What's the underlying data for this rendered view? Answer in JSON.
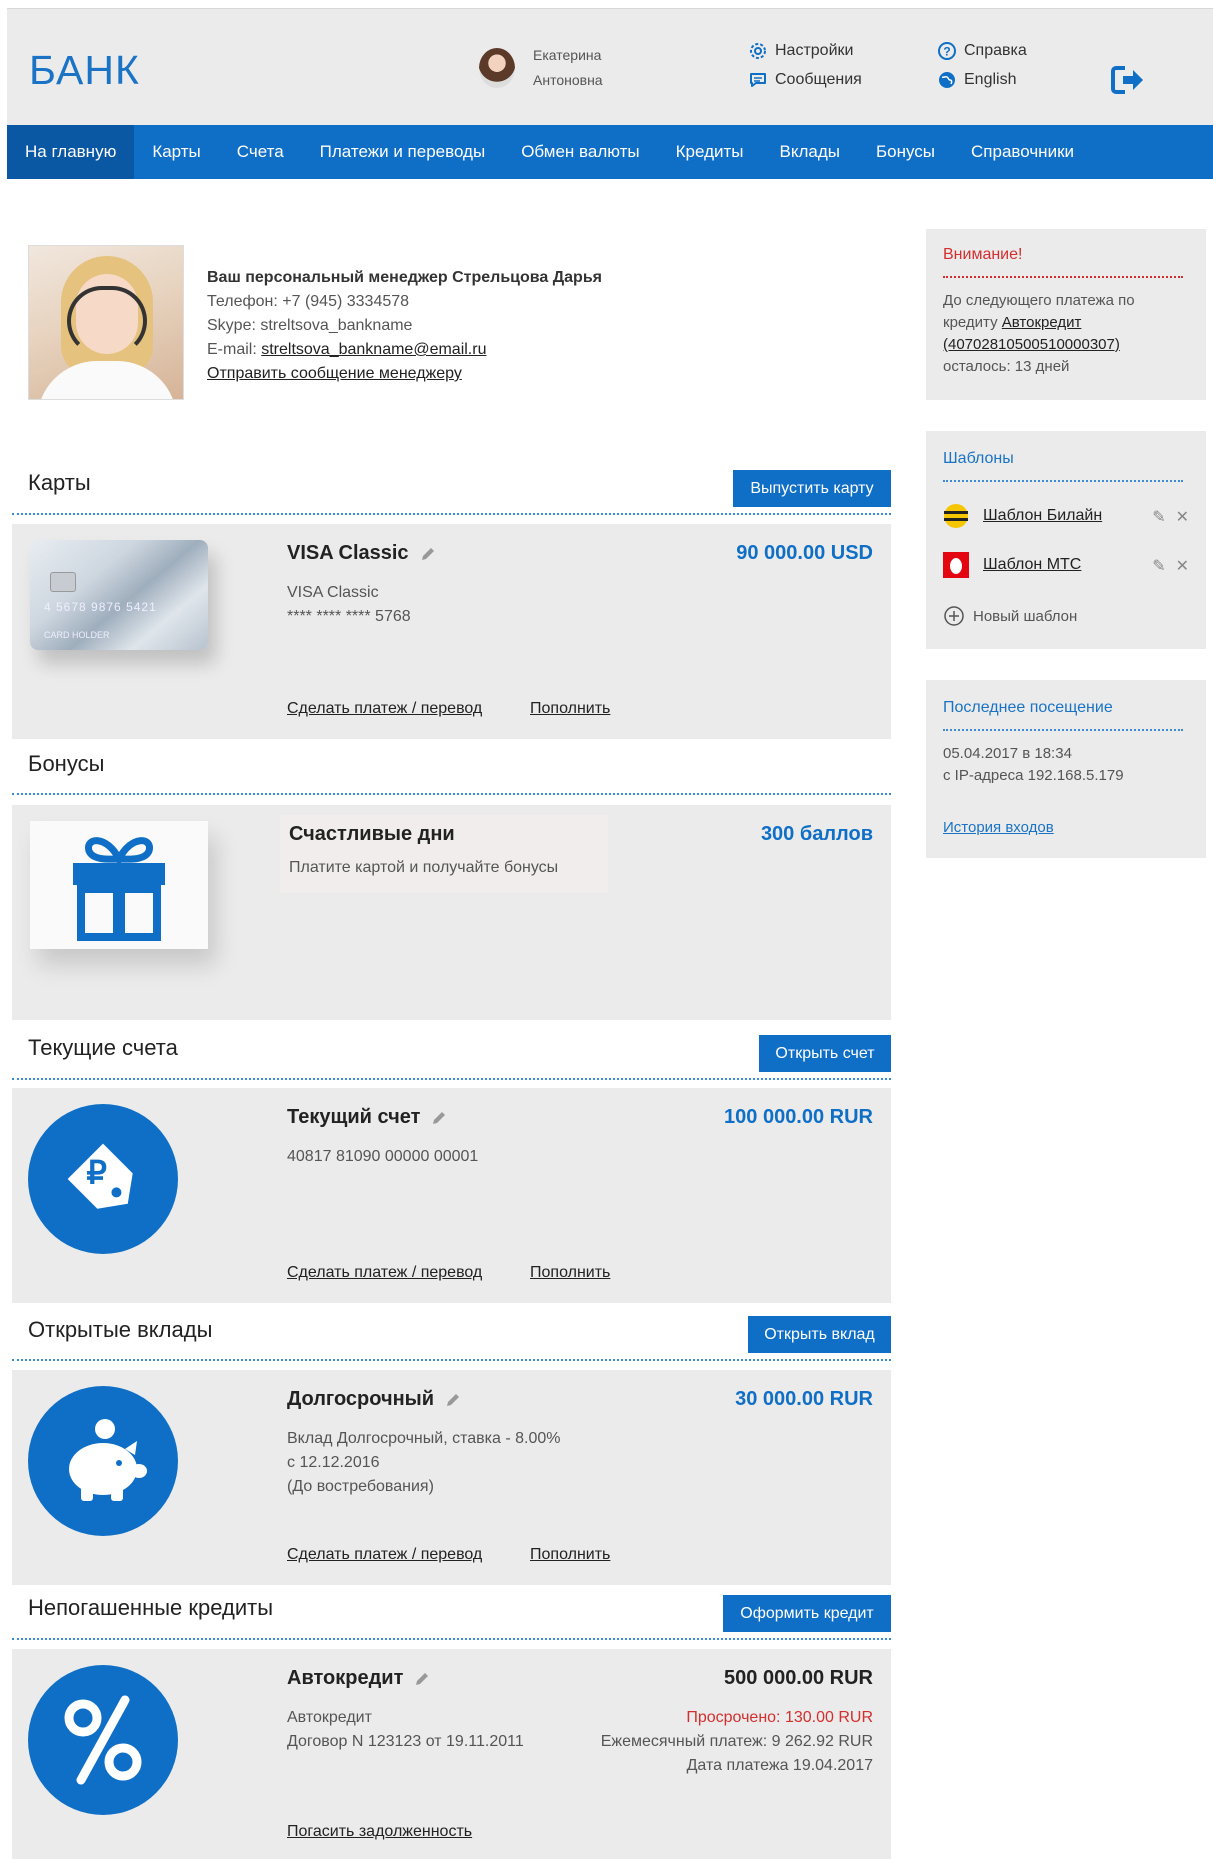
{
  "header": {
    "logo": "БАНК",
    "user_first": "Екатерина",
    "user_last": "Антоновна",
    "settings": "Настройки",
    "messages": "Сообщения",
    "help": "Справка",
    "language": "English"
  },
  "nav": [
    "На главную",
    "Карты",
    "Счета",
    "Платежи и переводы",
    "Обмен валюты",
    "Кредиты",
    "Вклады",
    "Бонусы",
    "Справочники"
  ],
  "manager": {
    "title": "Ваш персональный менеджер Стрельцова Дарья",
    "phone": "Телефон: +7 (945) 3334578",
    "skype": "Skype: streltsova_bankname",
    "email_label": "E-mail: ",
    "email": "streltsova_bankname@email.ru",
    "send_message": "Отправить сообщение менеджеру"
  },
  "cards": {
    "title": "Карты",
    "button": "Выпустить карту",
    "item": {
      "name": "VISA Classic",
      "amount": "90 000.00 USD",
      "desc": "VISA Classic",
      "number": "**** **** **** 5768",
      "card_number_print": "4 5678 9876 5421",
      "card_holder": "CARD HOLDER",
      "pay": "Сделать платеж / перевод",
      "topup": "Пополнить"
    }
  },
  "bonuses": {
    "title": "Бонусы",
    "item": {
      "name": "Счастливые дни",
      "amount": "300 баллов",
      "desc": "Платите картой и получайте бонусы"
    }
  },
  "accounts": {
    "title": "Текущие счета",
    "button": "Открыть счет",
    "item": {
      "name": "Текущий счет",
      "amount": "100 000.00 RUR",
      "number": "40817 81090 00000 00001",
      "pay": "Сделать платеж / перевод",
      "topup": "Пополнить"
    }
  },
  "deposits": {
    "title": "Открытые вклады",
    "button": "Открыть вклад",
    "item": {
      "name": "Долгосрочный",
      "amount": "30 000.00 RUR",
      "desc1": "Вклад Долгосрочный, ставка - 8.00%",
      "desc2": "с 12.12.2016",
      "desc3": "(До востребования)",
      "pay": "Сделать платеж / перевод",
      "topup": "Пополнить"
    }
  },
  "credits": {
    "title": "Непогашенные кредиты",
    "button": "Оформить кредит",
    "item": {
      "name": "Автокредит",
      "amount": "500 000.00 RUR",
      "desc1": "Автокредит",
      "desc2": "Договор N 123123 от 19.11.2011",
      "overdue": "Просрочено: 130.00 RUR",
      "monthly": "Ежемесячный платеж: 9 262.92 RUR",
      "date": "Дата платежа 19.04.2017",
      "repay": "Погасить задолженность"
    }
  },
  "sidebar": {
    "attention": {
      "title": "Внимание!",
      "text1": "До следующего платежа по кредиту ",
      "link": "Автокредит (40702810500510000307)",
      "text2": "осталось: 13 дней"
    },
    "templates": {
      "title": "Шаблоны",
      "items": [
        "Шаблон Билайн",
        "Шаблон МТС"
      ],
      "new": "Новый шаблон"
    },
    "last_visit": {
      "title": "Последнее посещение",
      "date": "05.04.2017 в 18:34",
      "ip": "с IP-адреса 192.168.5.179",
      "history": "История входов"
    }
  },
  "colors": {
    "accent": "#0f6fc6",
    "nav_active": "#0a57a3",
    "panel": "#ebebeb",
    "alert": "#d32f2f"
  }
}
